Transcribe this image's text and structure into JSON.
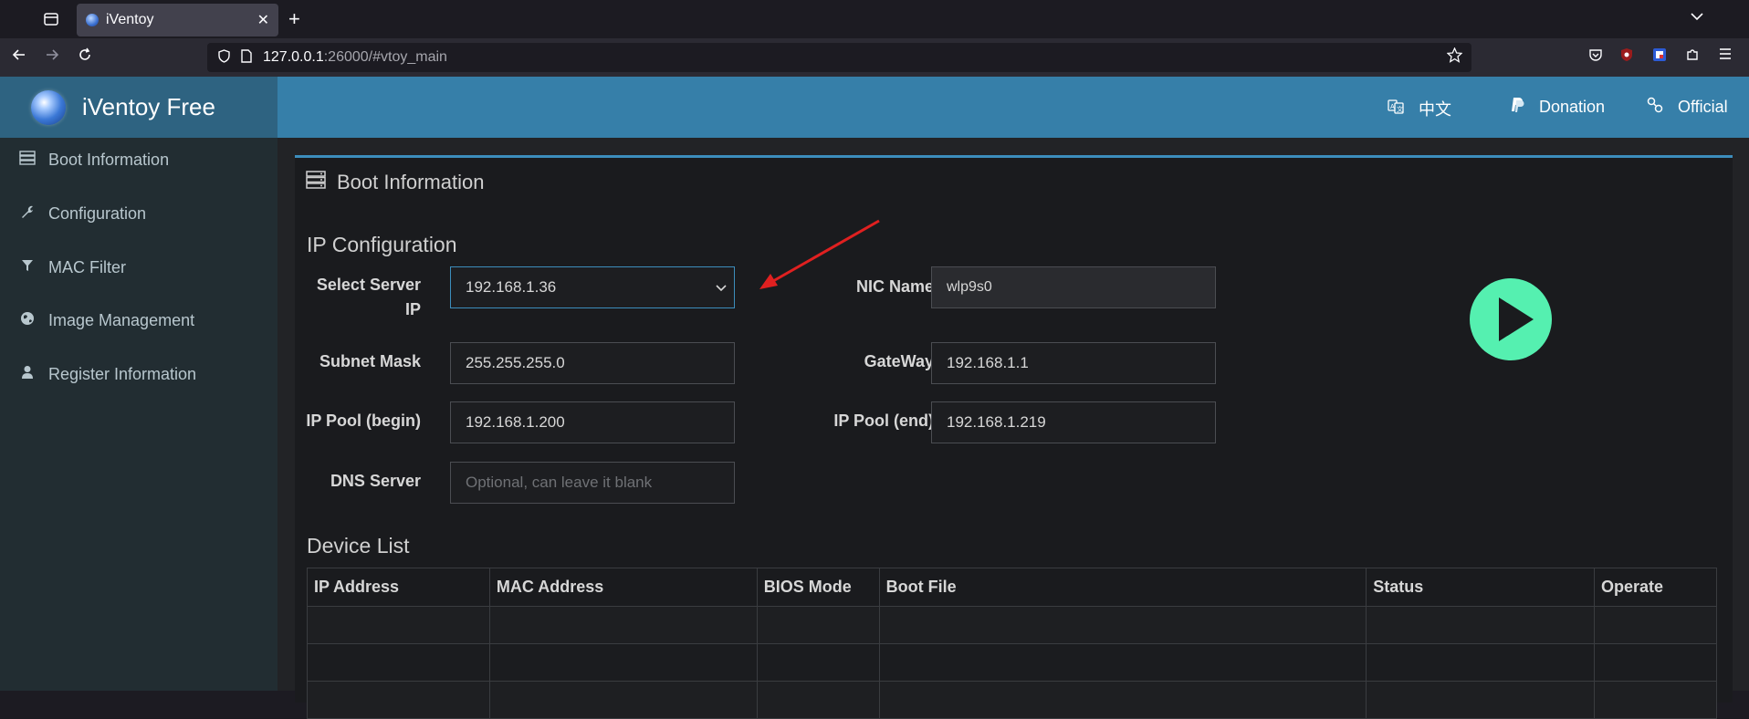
{
  "browser": {
    "tab_title": "iVentoy",
    "tab_close": "✕",
    "new_tab": "+",
    "url_host": "127.0.0.1",
    "url_rest": ":26000/#vtoy_main"
  },
  "app": {
    "brand": "iVentoy Free",
    "topbar": {
      "lang_label": "中文",
      "donation_label": "Donation",
      "official_label": "Official"
    },
    "sidebar": {
      "items": [
        {
          "label": "Boot Information",
          "icon": "server-icon"
        },
        {
          "label": "Configuration",
          "icon": "wrench-icon"
        },
        {
          "label": "MAC Filter",
          "icon": "filter-icon"
        },
        {
          "label": "Image Management",
          "icon": "globe-icon"
        },
        {
          "label": "Register Information",
          "icon": "user-icon"
        }
      ]
    },
    "main": {
      "box_title": "Boot Information",
      "ip_config_title": "IP Configuration",
      "fields": {
        "server_ip_label": "Select Server IP",
        "server_ip_value": "192.168.1.36",
        "nic_label": "NIC Name",
        "nic_value": "wlp9s0",
        "subnet_label": "Subnet Mask",
        "subnet_value": "255.255.255.0",
        "gateway_label": "GateWay",
        "gateway_value": "192.168.1.1",
        "pool_begin_label": "IP Pool (begin)",
        "pool_begin_value": "192.168.1.200",
        "pool_end_label": "IP Pool (end)",
        "pool_end_value": "192.168.1.219",
        "dns_label": "DNS Server",
        "dns_placeholder": "Optional, can leave it blank"
      },
      "device_list_title": "Device List",
      "device_columns": [
        "IP Address",
        "MAC Address",
        "BIOS Mode",
        "Boot File",
        "Status",
        "Operate"
      ],
      "device_rows": []
    }
  },
  "colors": {
    "brand_bg": "#2e6381",
    "topbar_bg": "#367fa9",
    "accent": "#3c8dbc",
    "play_button": "#55f0b0",
    "annotation_arrow": "#e02020"
  }
}
